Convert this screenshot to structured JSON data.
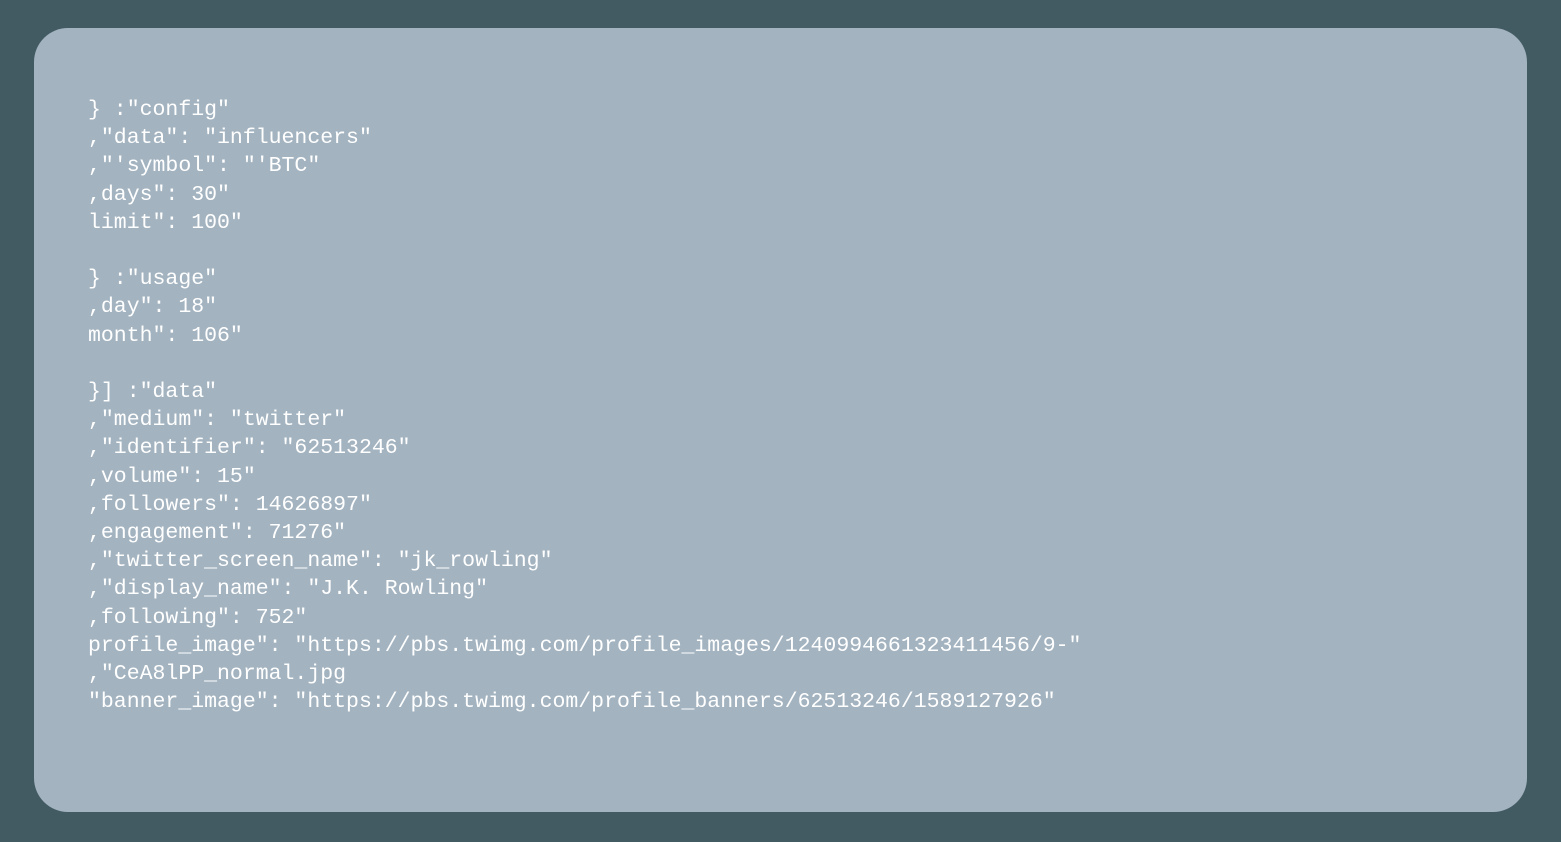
{
  "code": {
    "lines": [
      "} :\"config\"",
      ",\"data\": \"influencers\"",
      ",\"'symbol\": \"'BTC\"",
      ",days\": 30\"",
      "limit\": 100\"",
      "",
      "} :\"usage\"",
      ",day\": 18\"",
      "month\": 106\"",
      "",
      "}] :\"data\"",
      ",\"medium\": \"twitter\"",
      ",\"identifier\": \"62513246\"",
      ",volume\": 15\"",
      ",followers\": 14626897\"",
      ",engagement\": 71276\"",
      ",\"twitter_screen_name\": \"jk_rowling\"",
      ",\"display_name\": \"J.K. Rowling\"",
      ",following\": 752\"",
      "profile_image\": \"https://pbs.twimg.com/profile_images/1240994661323411456/9-\"",
      ",\"CeA8lPP_normal.jpg",
      "\"banner_image\": \"https://pbs.twimg.com/profile_banners/62513246/1589127926\""
    ]
  }
}
